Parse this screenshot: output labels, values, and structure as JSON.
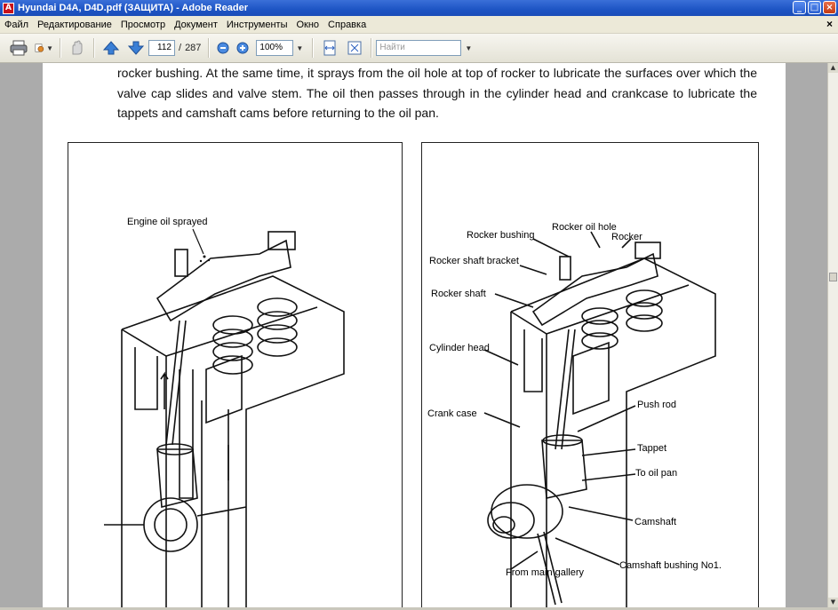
{
  "window": {
    "title": "Hyundai D4A, D4D.pdf (ЗАЩИТА) - Adobe Reader",
    "controls": [
      "_",
      "□",
      "×"
    ]
  },
  "menu": {
    "items": [
      "Файл",
      "Редактирование",
      "Просмотр",
      "Документ",
      "Инструменты",
      "Окно",
      "Справка"
    ],
    "close": "×"
  },
  "toolbar": {
    "page_current": "112",
    "page_separator": "/",
    "page_total": "287",
    "zoom": "100%",
    "search_placeholder": "Найти"
  },
  "document": {
    "paragraph": "rocker bushing. At the same time,  it sprays from the oil hole at top of rocker to lubricate the surfaces over which the valve cap slides and valve stem. The oil then passes through in the cylinder head and crankcase to lubricate the tappets  and camshaft cams before returning to the oil pan.",
    "figure_left": {
      "callouts": [
        "Engine oil sprayed"
      ]
    },
    "figure_right": {
      "callouts": [
        "Rocker bushing",
        "Rocker oil hole",
        "Rocker",
        "Rocker shaft bracket",
        "Rocker shaft",
        "Cylinder head",
        "Crank case",
        "Push rod",
        "Tappet",
        "To oil pan",
        "Camshaft",
        "Camshaft bushing No1.",
        "From main gallery"
      ]
    }
  }
}
